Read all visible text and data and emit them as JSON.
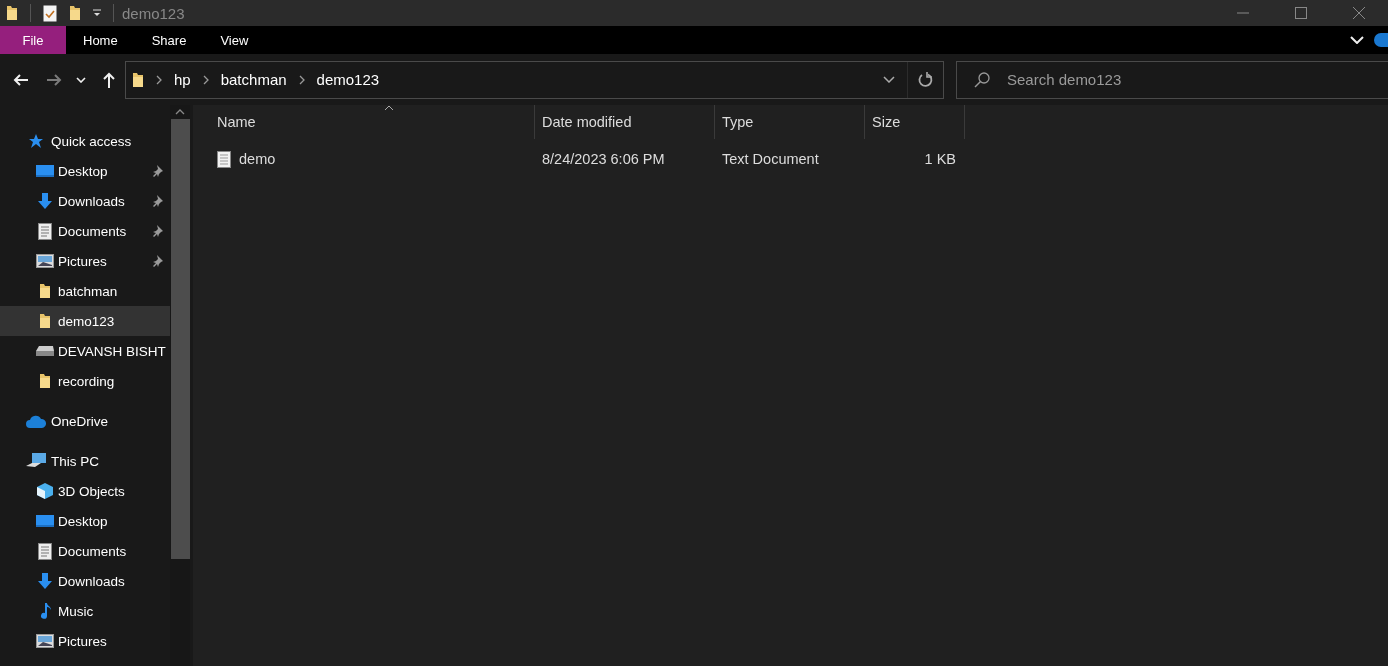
{
  "window": {
    "title": "demo123"
  },
  "ribbon": {
    "tabs": [
      {
        "label": "File",
        "kind": "file"
      },
      {
        "label": "Home",
        "kind": "tab"
      },
      {
        "label": "Share",
        "kind": "tab"
      },
      {
        "label": "View",
        "kind": "tab"
      }
    ]
  },
  "nav_buttons": [
    {
      "kind": "back",
      "disabled": false
    },
    {
      "kind": "forward",
      "disabled": true
    },
    {
      "kind": "recent",
      "disabled": false
    },
    {
      "kind": "up",
      "disabled": false
    }
  ],
  "address": {
    "segments": [
      "hp",
      "batchman",
      "demo123"
    ]
  },
  "search": {
    "placeholder": "Search demo123"
  },
  "sidebar": {
    "items": [
      {
        "label": "Quick access",
        "kind": "star",
        "selected": false,
        "pinned": false,
        "children": [
          {
            "label": "Desktop",
            "kind": "desktop",
            "selected": false,
            "pinned": true
          },
          {
            "label": "Downloads",
            "kind": "download",
            "selected": false,
            "pinned": true
          },
          {
            "label": "Documents",
            "kind": "document",
            "selected": false,
            "pinned": true
          },
          {
            "label": "Pictures",
            "kind": "pictures",
            "selected": false,
            "pinned": true
          },
          {
            "label": "batchman",
            "kind": "folder",
            "selected": false,
            "pinned": false
          },
          {
            "label": "demo123",
            "kind": "folder",
            "selected": true,
            "pinned": false
          },
          {
            "label": "DEVANSH BISHT",
            "kind": "drive",
            "selected": false,
            "pinned": false
          },
          {
            "label": "recording",
            "kind": "folder",
            "selected": false,
            "pinned": false
          }
        ]
      },
      {
        "label": "OneDrive",
        "kind": "cloud",
        "selected": false,
        "pinned": false
      },
      {
        "label": "This PC",
        "kind": "pc",
        "selected": false,
        "pinned": false,
        "children": [
          {
            "label": "3D Objects",
            "kind": "cube",
            "selected": false,
            "pinned": false
          },
          {
            "label": "Desktop",
            "kind": "desktop",
            "selected": false,
            "pinned": false
          },
          {
            "label": "Documents",
            "kind": "document",
            "selected": false,
            "pinned": false
          },
          {
            "label": "Downloads",
            "kind": "download",
            "selected": false,
            "pinned": false
          },
          {
            "label": "Music",
            "kind": "music",
            "selected": false,
            "pinned": false
          },
          {
            "label": "Pictures",
            "kind": "pictures",
            "selected": false,
            "pinned": false
          }
        ]
      }
    ]
  },
  "table": {
    "columns": [
      {
        "label": "Name",
        "sorted": true
      },
      {
        "label": "Date modified",
        "sorted": false
      },
      {
        "label": "Type",
        "sorted": false
      },
      {
        "label": "Size",
        "sorted": false
      }
    ],
    "rows": [
      {
        "name": "demo",
        "date_modified": "8/24/2023 6:06 PM",
        "type": "Text Document",
        "size": "1 KB"
      }
    ]
  }
}
